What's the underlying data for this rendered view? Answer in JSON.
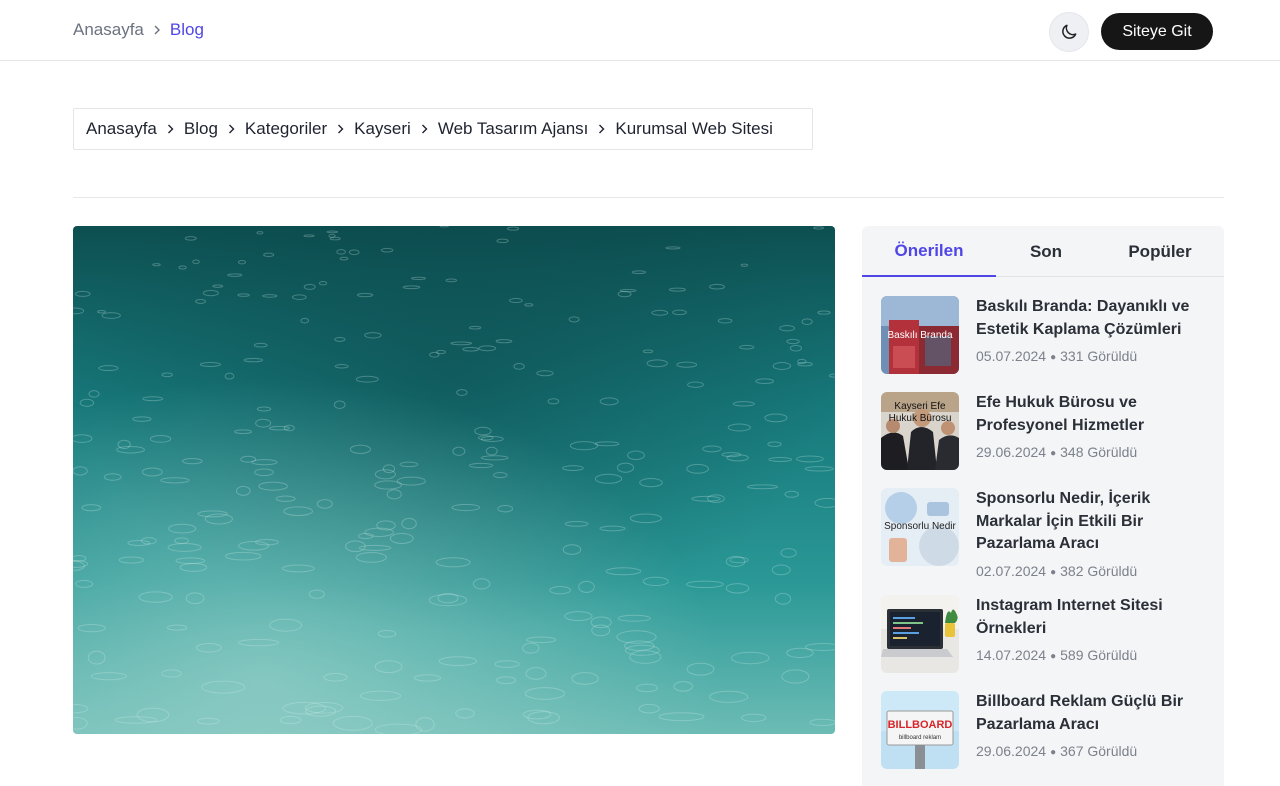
{
  "topbar": {
    "crumb_home": "Anasayfa",
    "crumb_current": "Blog",
    "theme_icon": "moon-icon",
    "site_button": "Siteye Git"
  },
  "breadcrumb": [
    "Anasayfa",
    "Blog",
    "Kategoriler",
    "Kayseri",
    "Web Tasarım Ajansı",
    "Kurumsal Web Sitesi"
  ],
  "sidebar": {
    "tabs": [
      "Önerilen",
      "Son",
      "Popüler"
    ],
    "active_tab": "Önerilen",
    "posts": [
      {
        "title": "Baskılı Branda: Dayanıklı ve Estetik Kaplama Çözümleri",
        "date": "05.07.2024",
        "views": "331 Görüldü",
        "thumb_text": "Baskılı Branda"
      },
      {
        "title": "Efe Hukuk Bürosu ve Profesyonel Hizmetler",
        "date": "29.06.2024",
        "views": "348 Görüldü",
        "thumb_text_1": "Kayseri Efe",
        "thumb_text_2": "Hukuk Bürosu"
      },
      {
        "title": "Sponsorlu Nedir, İçerik Markalar İçin Etkili Bir Pazarlama Aracı",
        "date": "02.07.2024",
        "views": "382 Görüldü",
        "thumb_text": "Sponsorlu Nedir"
      },
      {
        "title": "Instagram Internet Sitesi Örnekleri",
        "date": "14.07.2024",
        "views": "589 Görüldü"
      },
      {
        "title": "Billboard Reklam Güçlü Bir Pazarlama Aracı",
        "date": "29.06.2024",
        "views": "367 Görüldü",
        "thumb_text": "BILLBOARD",
        "thumb_subtext": "billboard reklam"
      }
    ]
  },
  "colors": {
    "accent": "#4f46e5",
    "button_bg": "#161616",
    "sidebar_bg": "#f4f5f7"
  }
}
